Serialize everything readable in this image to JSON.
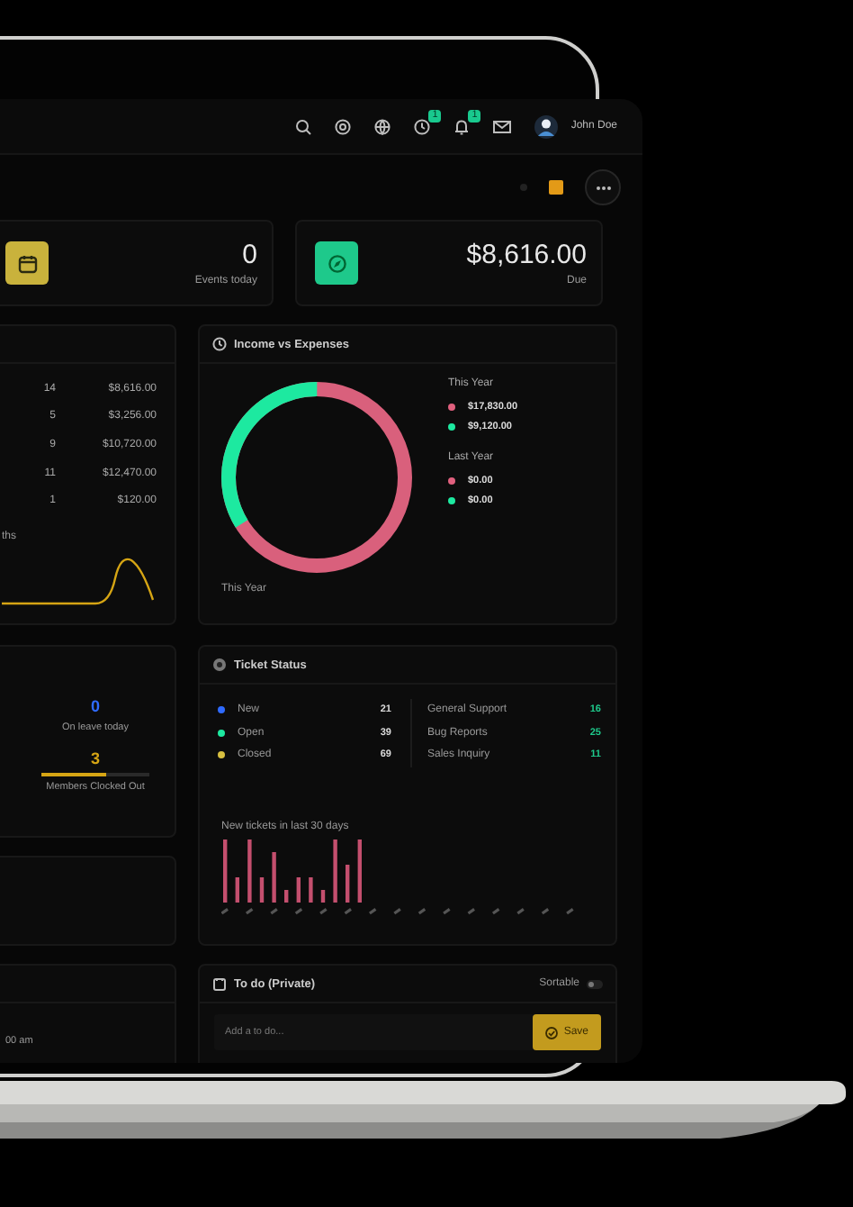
{
  "topbar": {
    "badges": [
      "1",
      "1"
    ],
    "user_name": "John Doe"
  },
  "summary_cards": [
    {
      "value": "0",
      "label": "Events today",
      "color": "#c9b23c"
    },
    {
      "value": "$8,616.00",
      "label": "Due",
      "color": "#1ec98b"
    }
  ],
  "invoices": {
    "rows": [
      {
        "count": "14",
        "amount": "$8,616.00"
      },
      {
        "count": "5",
        "amount": "$3,256.00"
      },
      {
        "count": "9",
        "amount": "$10,720.00"
      },
      {
        "count": "11",
        "amount": "$12,470.00"
      },
      {
        "count": "1",
        "amount": "$120.00"
      }
    ],
    "caption": "ths"
  },
  "income_expenses": {
    "title": "Income vs Expenses",
    "legend_groups": [
      {
        "title": "This Year",
        "items": [
          {
            "value": "$17,830.00",
            "color": "#e0607e"
          },
          {
            "value": "$9,120.00",
            "color": "#1de9a0"
          }
        ]
      },
      {
        "title": "Last Year",
        "items": [
          {
            "value": "$0.00",
            "color": "#e0607e"
          },
          {
            "value": "$0.00",
            "color": "#1de9a0"
          }
        ]
      }
    ],
    "footer": "This Year"
  },
  "attendance": {
    "on_leave": {
      "value": "0",
      "label": "On leave today"
    },
    "clocked_out": {
      "value": "3",
      "label": "Members Clocked Out",
      "level": 0.6
    }
  },
  "ticket_status": {
    "title": "Ticket Status",
    "statuses": [
      {
        "label": "New",
        "count": "21",
        "color": "#2f6bff"
      },
      {
        "label": "Open",
        "count": "39",
        "color": "#1de9a0"
      },
      {
        "label": "Closed",
        "count": "69",
        "color": "#d8c040"
      }
    ],
    "categories": [
      {
        "label": "General Support",
        "count": "16"
      },
      {
        "label": "Bug Reports",
        "count": "25"
      },
      {
        "label": "Sales Inquiry",
        "count": "11"
      }
    ],
    "chart_title": "New tickets in last 30 days"
  },
  "partial_card": {
    "time": "00 am"
  },
  "todo": {
    "title": "To do (Private)",
    "sortable_label": "Sortable",
    "sortable_on": false,
    "placeholder": "Add a to do...",
    "save_label": "Save"
  }
}
